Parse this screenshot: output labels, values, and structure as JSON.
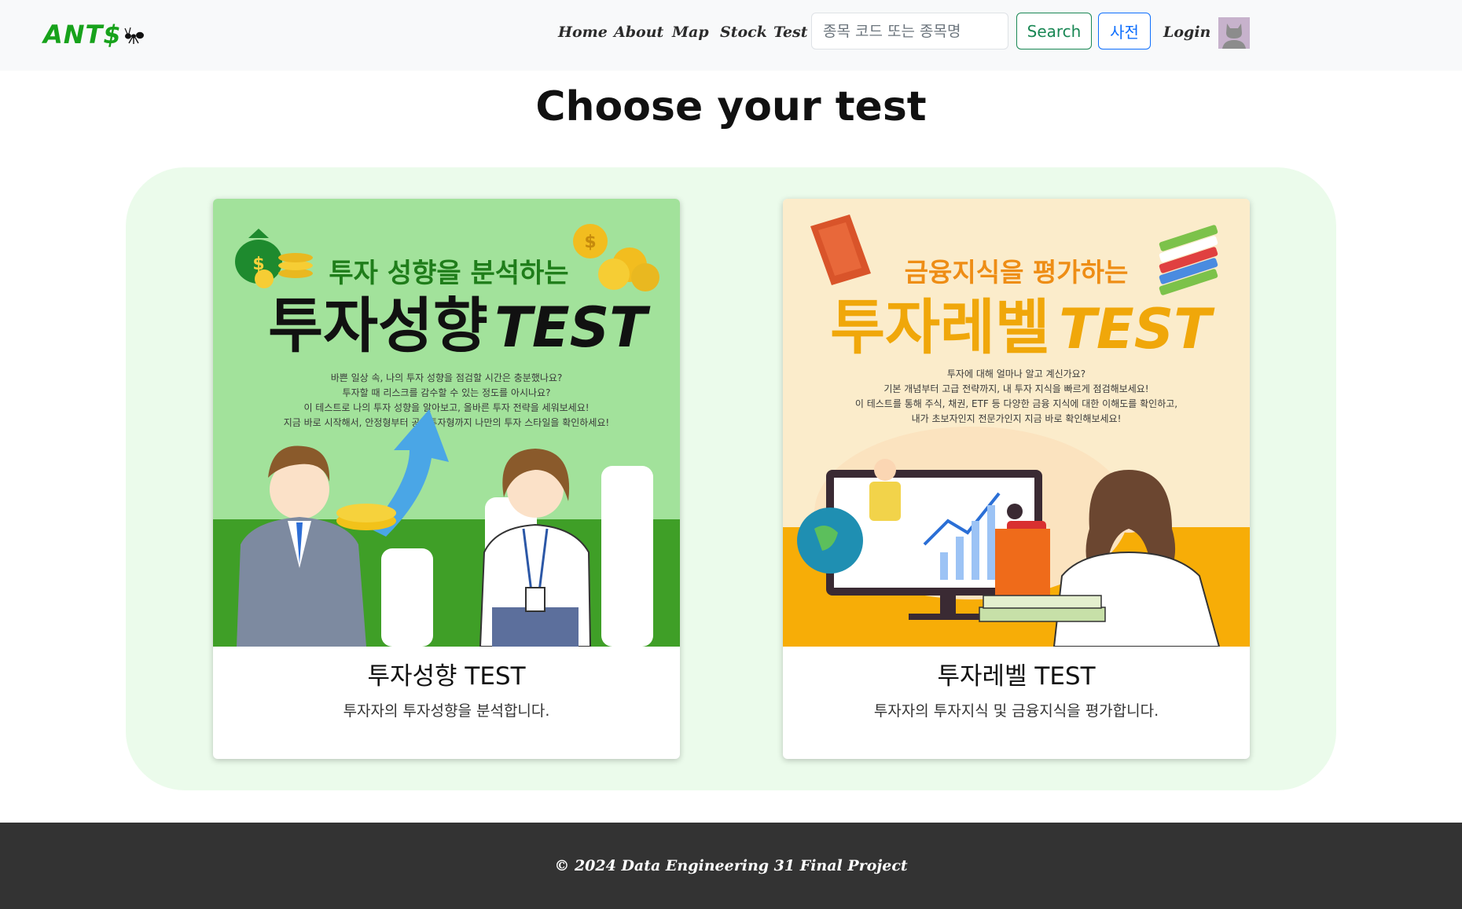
{
  "nav": {
    "brand": "ANT$",
    "links": [
      "Home",
      "About",
      "Map",
      "Stock",
      "Test"
    ],
    "search_placeholder": "종목 코드 또는 종목명",
    "search_button": "Search",
    "dict_button": "사전",
    "login": "Login"
  },
  "main": {
    "title": "Choose your test",
    "cards": [
      {
        "title": "투자성향 TEST",
        "description": "투자자의 투자성향을 분석합니다.",
        "poster": {
          "subtitle": "투자 성향을 분석하는",
          "headline": "투자성향",
          "headline_en": "TEST",
          "lines": [
            "바쁜 일상 속, 나의 투자 성향을 점검할 시간은 충분했나요?",
            "투자할 때 리스크를 감수할 수 있는 정도를 아시나요?",
            "이 테스트로 나의 투자 성향을 알아보고, 올바른 투자 전략을 세워보세요!",
            "지금 바로 시작해서, 안정형부터 공격투자형까지 나만의 투자 스타일을 확인하세요!"
          ],
          "colors": {
            "bg": "#a2e29b",
            "ground": "#3f9f27",
            "headline": "#111111",
            "subtitle": "#1f7d1a"
          }
        }
      },
      {
        "title": "투자레벨 TEST",
        "description": "투자자의 투자지식 및 금융지식을 평가합니다.",
        "poster": {
          "subtitle": "금융지식을 평가하는",
          "headline": "투자레벨",
          "headline_en": "TEST",
          "lines": [
            "투자에 대해 얼마나 알고 계신가요?",
            "기본 개념부터 고급 전략까지, 내 투자 지식을 빠르게 점검해보세요!",
            "이 테스트를 통해 주식, 채권, ETF 등 다양한 금융 지식에 대한 이해도를 확인하고,",
            "내가 초보자인지 전문가인지 지금 바로 확인해보세요!"
          ],
          "colors": {
            "bg": "#fbeccb",
            "ground": "#f7ad07",
            "headline": "#f0a70a",
            "subtitle": "#ee8d15"
          }
        }
      }
    ]
  },
  "footer": {
    "text": "© 2024 Data Engineering 31 Final Project"
  }
}
